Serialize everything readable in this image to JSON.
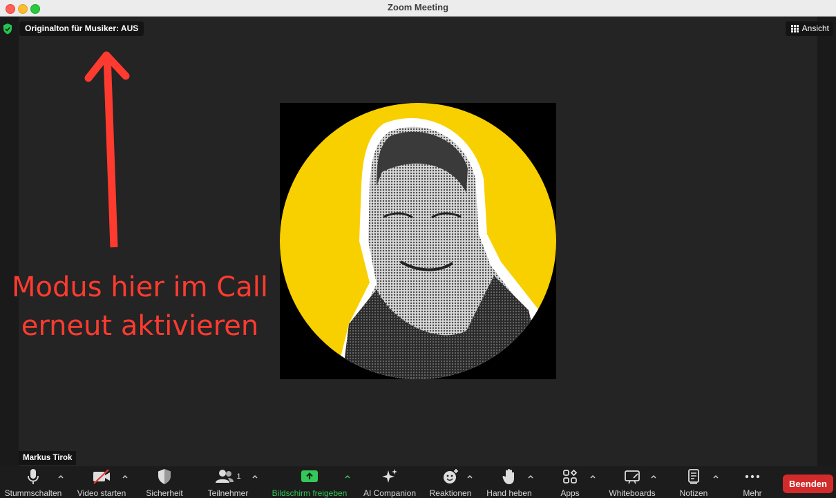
{
  "window": {
    "title": "Zoom Meeting"
  },
  "meeting": {
    "audio_badge": "Originalton für Musiker: AUS",
    "view_label": "Ansicht",
    "participant_name": "Markus Tirok",
    "annotation": [
      "Modus hier im Call",
      "erneut aktivieren"
    ]
  },
  "toolbar": {
    "mute": "Stummschalten",
    "video": "Video starten",
    "security": "Sicherheit",
    "participants": "Teilnehmer",
    "participants_count": "1",
    "share": "Bildschirm freigeben",
    "ai": "AI Companion",
    "reactions": "Reaktionen",
    "raise_hand": "Hand heben",
    "apps": "Apps",
    "whiteboards": "Whiteboards",
    "notes": "Notizen",
    "more": "Mehr",
    "end": "Beenden"
  },
  "colors": {
    "annotation": "#ff3b30",
    "share_green": "#34c759",
    "end_red": "#d22b2b",
    "avatar_yellow": "#f8d000"
  }
}
